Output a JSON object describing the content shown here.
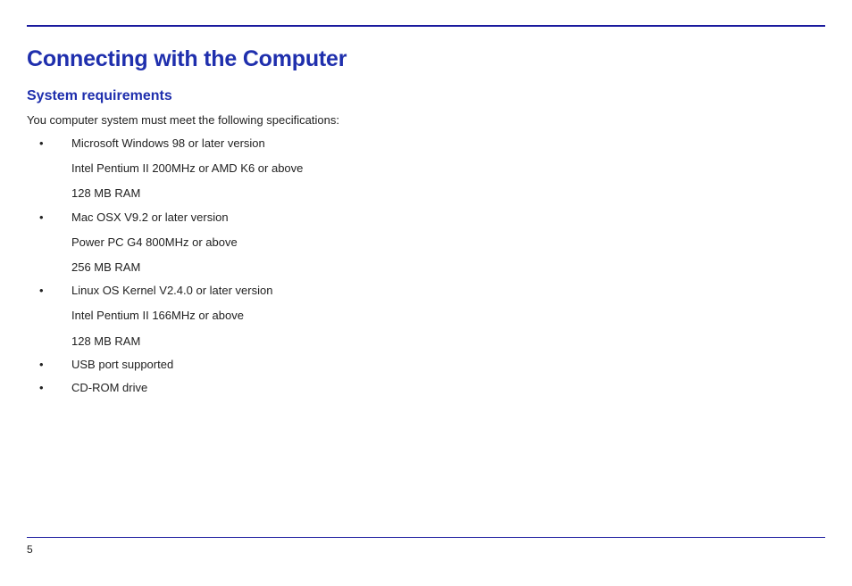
{
  "page": {
    "title": "Connecting with the Computer",
    "number": "5"
  },
  "section": {
    "title": "System requirements",
    "intro": "You computer system must meet the following specifications:"
  },
  "requirements": [
    {
      "lines": [
        "Microsoft Windows 98 or later version",
        "Intel Pentium II 200MHz or AMD K6 or above",
        "128 MB RAM"
      ]
    },
    {
      "lines": [
        "Mac OSX V9.2 or later version",
        "Power PC G4 800MHz or above",
        "256 MB RAM"
      ]
    },
    {
      "lines": [
        "Linux OS Kernel V2.4.0 or later version",
        "Intel Pentium II 166MHz or above",
        "128 MB RAM"
      ]
    },
    {
      "lines": [
        "USB port supported"
      ]
    },
    {
      "lines": [
        "CD-ROM drive"
      ]
    }
  ]
}
